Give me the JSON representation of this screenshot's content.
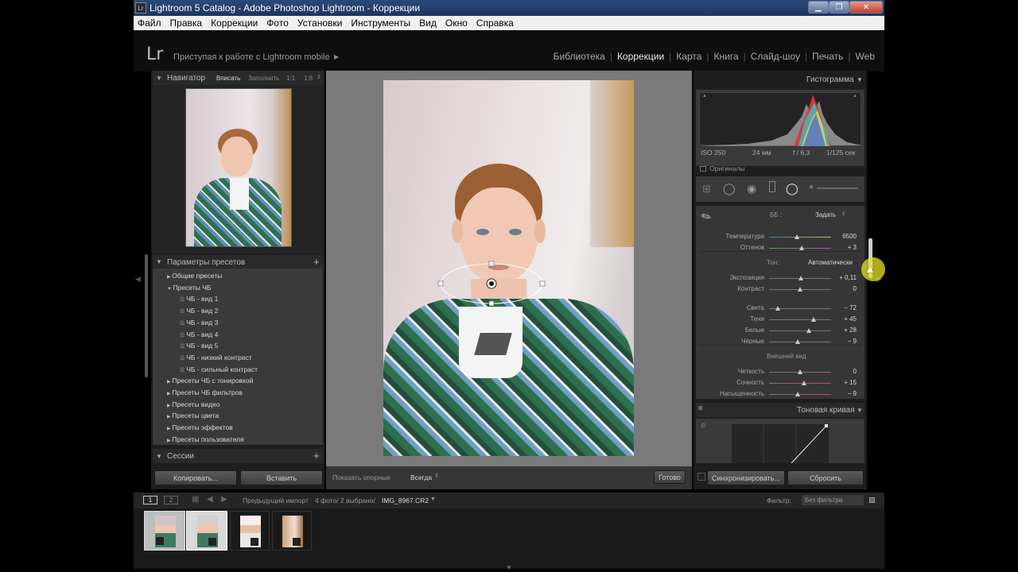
{
  "window": {
    "title": "Lightroom 5 Catalog - Adobe Photoshop Lightroom - Коррекции",
    "icon_label": "Lr"
  },
  "menu": [
    "Файл",
    "Правка",
    "Коррекции",
    "Фото",
    "Установки",
    "Инструменты",
    "Вид",
    "Окно",
    "Справка"
  ],
  "header": {
    "logo": "Lr",
    "identity": "Приступая к работе с Lightroom mobile",
    "modules": [
      "Библиотека",
      "Коррекции",
      "Карта",
      "Книга",
      "Слайд-шоу",
      "Печать",
      "Web"
    ],
    "active_module": "Коррекции"
  },
  "navigator": {
    "title": "Навигатор",
    "zoom": [
      "Вписать",
      "Заполнить",
      "1:1",
      "1:8"
    ]
  },
  "presets": {
    "title": "Параметры пресетов",
    "items": [
      {
        "label": "Общие пресеты",
        "type": "folder",
        "open": false
      },
      {
        "label": "Пресеты ЧБ",
        "type": "folder",
        "open": true
      },
      {
        "label": "ЧБ - вид 1",
        "type": "preset"
      },
      {
        "label": "ЧБ - вид 2",
        "type": "preset"
      },
      {
        "label": "ЧБ - вид 3",
        "type": "preset"
      },
      {
        "label": "ЧБ - вид 4",
        "type": "preset"
      },
      {
        "label": "ЧБ - вид 5",
        "type": "preset"
      },
      {
        "label": "ЧБ - низкий контраст",
        "type": "preset"
      },
      {
        "label": "ЧБ - сильный контраст",
        "type": "preset"
      },
      {
        "label": "Пресеты ЧБ с тонировкой",
        "type": "folder",
        "open": false
      },
      {
        "label": "Пресеты ЧБ фильтров",
        "type": "folder",
        "open": false
      },
      {
        "label": "Пресеты видео",
        "type": "folder",
        "open": false
      },
      {
        "label": "Пресеты цвета",
        "type": "folder",
        "open": false
      },
      {
        "label": "Пресеты эффектов",
        "type": "folder",
        "open": false
      },
      {
        "label": "Пресеты пользователя",
        "type": "folder",
        "open": false
      }
    ]
  },
  "sessions": {
    "title": "Сессии"
  },
  "left_buttons": {
    "copy": "Копировать...",
    "paste": "Вставить"
  },
  "toolbar": {
    "show_pins": "Показать опорные",
    "pins_value": "Всегда",
    "done": "Готово"
  },
  "histogram": {
    "title": "Гистограмма",
    "iso": "ISO 250",
    "focal": "24 мм",
    "aperture": "f / 6,3",
    "shutter": "1/125 сек",
    "originals": "Оригиналы"
  },
  "basic": {
    "wb_label": "ББ :",
    "wb_value": "Задать",
    "tone_label": "Тон:",
    "tone_auto": "Автоматически",
    "presence_label": "Внешний вид",
    "sliders": [
      {
        "label": "Температура",
        "value": "6500",
        "pos": 0.45,
        "color": "temp"
      },
      {
        "label": "Оттенок",
        "value": "+ 3",
        "pos": 0.52,
        "color": "tint"
      },
      {
        "label": "Экспозиция",
        "value": "+ 0,11",
        "pos": 0.51,
        "color": "plain"
      },
      {
        "label": "Контраст",
        "value": "0",
        "pos": 0.5,
        "color": "plain"
      },
      {
        "label": "Света",
        "value": "− 72",
        "pos": 0.14,
        "color": "plain"
      },
      {
        "label": "Тени",
        "value": "+ 45",
        "pos": 0.72,
        "color": "plain"
      },
      {
        "label": "Белые",
        "value": "+ 28",
        "pos": 0.64,
        "color": "plain"
      },
      {
        "label": "Чёрные",
        "value": "− 9",
        "pos": 0.46,
        "color": "plain"
      },
      {
        "label": "Четкость",
        "value": "0",
        "pos": 0.5,
        "color": "plain"
      },
      {
        "label": "Сочность",
        "value": "+ 15",
        "pos": 0.57,
        "color": "vib"
      },
      {
        "label": "Насыщенность",
        "value": "− 9",
        "pos": 0.46,
        "color": "vib"
      }
    ]
  },
  "tone_curve": {
    "title": "Тоновая кривая"
  },
  "right_buttons": {
    "sync": "Синхронизировать...",
    "reset": "Сбросить"
  },
  "filmstrip": {
    "pages": [
      "1",
      "2"
    ],
    "source": "Предыдущий импорт",
    "count": "4 фото/ 2 выбрано/",
    "file": "IMG_8967.CR2",
    "filter_label": "Фильтр:",
    "filter_value": "Без фильтра"
  },
  "colors": {
    "accent": "#e8e8e8",
    "panel": "#1e1e1e",
    "bg": "#7a7a7a"
  }
}
